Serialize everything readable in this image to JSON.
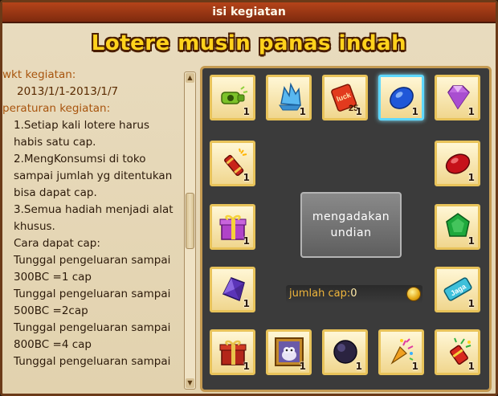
{
  "window": {
    "title": "isi kegiatan"
  },
  "event": {
    "title": "Lotere musin panas indah"
  },
  "info": {
    "period_label": "wkt kegiatan:",
    "period_value": "2013/1/1-2013/1/7",
    "rules_label": "peraturan kegiatan:",
    "rules": [
      "1.Setiap kali lotere harus",
      "habis satu cap.",
      "2.MengKonsumsi di toko",
      "sampai jumlah yg ditentukan",
      "bisa dapat cap.",
      "3.Semua hadiah menjadi alat",
      "khusus.",
      "Cara dapat cap:",
      "Tunggal pengeluaran sampai",
      "300BC =1 cap",
      "Tunggal pengeluaran sampai",
      "500BC =2cap",
      "Tunggal pengeluaran sampai",
      "800BC =4 cap",
      "Tunggal pengeluaran sampai"
    ]
  },
  "draw": {
    "button_label": "mengadakan\nundian"
  },
  "cap": {
    "label": "jumlah cap:",
    "value": "0"
  },
  "slots": [
    {
      "icon": "green-whistle-icon",
      "count": "1"
    },
    {
      "icon": "blue-crystal-icon",
      "count": "1"
    },
    {
      "icon": "luck-ticket-icon",
      "count": "1",
      "badge": "25"
    },
    {
      "icon": "sapphire-gem-icon",
      "count": "1",
      "selected": true
    },
    {
      "icon": "pink-diamond-icon",
      "count": "1"
    },
    {
      "icon": "firecracker-icon",
      "count": "1"
    },
    {
      "icon": "ruby-gem-icon",
      "count": "1"
    },
    {
      "icon": "gift-box-icon",
      "count": "1"
    },
    {
      "icon": "emerald-gem-icon",
      "count": "1"
    },
    {
      "icon": "amethyst-gem-icon",
      "count": "1"
    },
    {
      "icon": "cyan-tag-icon",
      "count": "1",
      "badge": "Jaga"
    },
    {
      "icon": "red-gift-box-icon",
      "count": "1"
    },
    {
      "icon": "pet-portrait-icon",
      "count": "1"
    },
    {
      "icon": "dark-orb-icon",
      "count": "1"
    },
    {
      "icon": "party-popper-icon",
      "count": "1"
    },
    {
      "icon": "confetti-cannon-icon",
      "count": "1"
    }
  ],
  "colors": {
    "accent": "#ffd21c",
    "title_bar": "#a23a14",
    "board": "#3b3b3b",
    "selected_border": "#5fd8ff"
  }
}
